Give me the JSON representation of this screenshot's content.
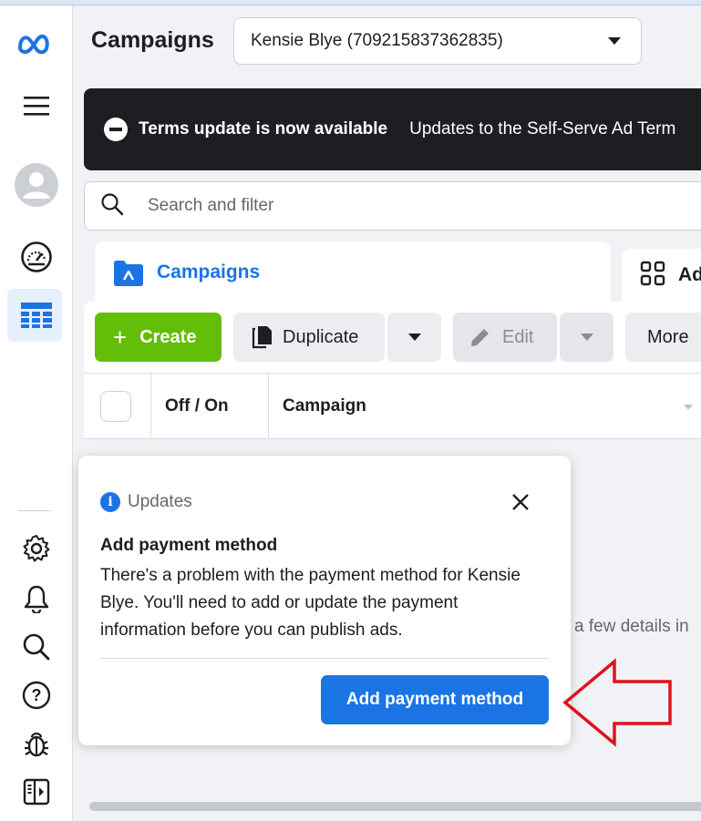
{
  "header": {
    "title": "Campaigns",
    "account_selector": "Kensie Blye (709215837362835)"
  },
  "banner": {
    "title": "Terms update is now available",
    "text": "Updates to the Self-Serve Ad Term"
  },
  "search": {
    "placeholder": "Search and filter"
  },
  "tabs": [
    {
      "label": "Campaigns",
      "active": true
    },
    {
      "label": "Ad"
    }
  ],
  "toolbar": {
    "create": "Create",
    "duplicate": "Duplicate",
    "edit": "Edit",
    "more": "More"
  },
  "table": {
    "columns": [
      "Off / On",
      "Campaign"
    ]
  },
  "background_text": "a few details in",
  "popup": {
    "section": "Updates",
    "title": "Add payment method",
    "body": "There's a problem with the payment method for Kensie Blye. You'll need to add or update the payment information before you can publish ads.",
    "button": "Add payment method"
  },
  "sidebar": {
    "items": [
      "meta-logo",
      "menu",
      "account-avatar",
      "performance-overview",
      "ads-manager-campaigns",
      "settings",
      "notifications",
      "search",
      "help",
      "report-a-problem",
      "toggle-panel"
    ]
  },
  "colors": {
    "accent": "#1b74e4",
    "create_green": "#63be09",
    "banner_bg": "#1c1e21",
    "annotation_arrow": "#e0121c"
  }
}
